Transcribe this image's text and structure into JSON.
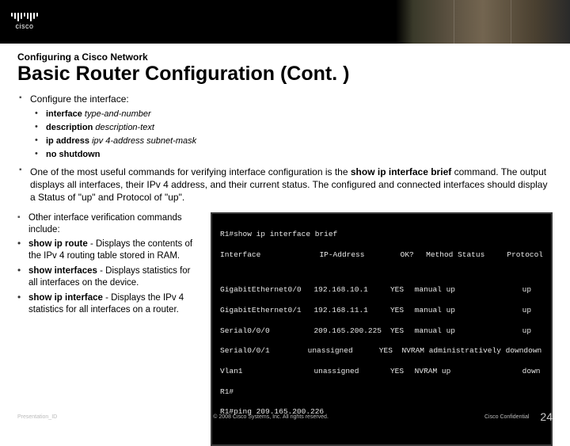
{
  "logo_text": "cisco",
  "super_title": "Configuring a Cisco Network",
  "title": "Basic Router Configuration (Cont. )",
  "section1_heading": "Configure the interface:",
  "cmds": [
    {
      "bold": "interface",
      "ital": "type-and-number"
    },
    {
      "bold": "description",
      "ital": "description-text"
    },
    {
      "bold": "ip address",
      "ital": "ipv 4-address subnet-mask"
    },
    {
      "bold": "no shutdown",
      "ital": ""
    }
  ],
  "para1_pre": "One of the most useful commands for verifying interface configuration is the ",
  "para1_bold": "show ip interface brief",
  "para1_post": " command. The output displays all interfaces, their IPv 4 address, and their current status. The configured and connected interfaces should display a Status of \"up\" and Protocol of \"up\".",
  "left_intro": "Other interface verification commands include:",
  "left_items": [
    {
      "b": "show ip route",
      "rest": " - Displays the contents of the IPv 4 routing table stored in RAM."
    },
    {
      "b": "show interfaces",
      "rest": " - Displays statistics for all interfaces on the device."
    },
    {
      "b": "show ip interface",
      "rest": " - Displays the IPv 4 statistics for all interfaces on a router."
    }
  ],
  "cli": {
    "prompt1": "R1#show ip interface brief",
    "headers": [
      "Interface",
      "IP-Address",
      "OK?",
      "Method Status",
      "Protocol"
    ],
    "rows": [
      [
        "GigabitEthernet0/0",
        "192.168.10.1",
        "YES",
        "manual up",
        "up"
      ],
      [
        "GigabitEthernet0/1",
        "192.168.11.1",
        "YES",
        "manual up",
        "up"
      ],
      [
        "Serial0/0/0",
        "209.165.200.225",
        "YES",
        "manual up",
        "up"
      ],
      [
        "Serial0/0/1",
        "unassigned",
        "YES",
        "NVRAM administratively down",
        "down"
      ],
      [
        "Vlan1",
        "unassigned",
        "YES",
        "NVRAM up",
        "down"
      ]
    ],
    "prompt2": "R1#",
    "prompt3": "R1#ping 209.165.200.226"
  },
  "footer": {
    "left": "Presentation_ID",
    "mid": "© 2008 Cisco Systems, Inc. All rights reserved.",
    "right": "Cisco Confidential",
    "page": "24"
  }
}
